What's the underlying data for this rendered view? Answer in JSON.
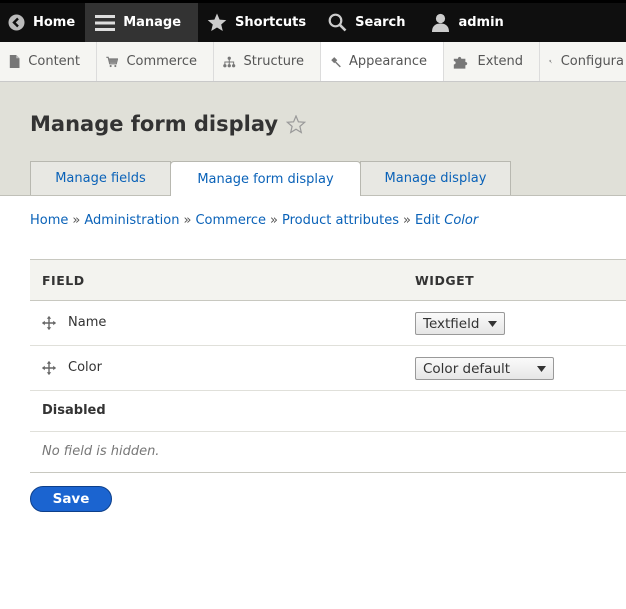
{
  "toolbar": {
    "home": "Home",
    "manage": "Manage",
    "shortcuts": "Shortcuts",
    "search": "Search",
    "user": "admin"
  },
  "tray": {
    "items": [
      "Content",
      "Commerce",
      "Structure",
      "Appearance",
      "Extend",
      "Configura"
    ]
  },
  "page": {
    "title": "Manage form display"
  },
  "tabs": [
    "Manage fields",
    "Manage form display",
    "Manage display"
  ],
  "breadcrumb": {
    "items": [
      "Home",
      "Administration",
      "Commerce",
      "Product attributes"
    ],
    "separator": "»",
    "edit_prefix": "Edit",
    "edit_entity": "Color"
  },
  "table": {
    "headers": {
      "field": "FIELD",
      "widget": "WIDGET"
    },
    "rows": [
      {
        "label": "Name",
        "widget": "Textfield"
      },
      {
        "label": "Color",
        "widget": "Color default"
      }
    ],
    "disabled_label": "Disabled",
    "empty_message": "No field is hidden."
  },
  "actions": {
    "save": "Save"
  },
  "colors": {
    "toolbar_bg": "#0f0f0f",
    "link": "#0a62b8",
    "primary_button": "#1b64d0",
    "header_bg": "#e0e0d8"
  }
}
